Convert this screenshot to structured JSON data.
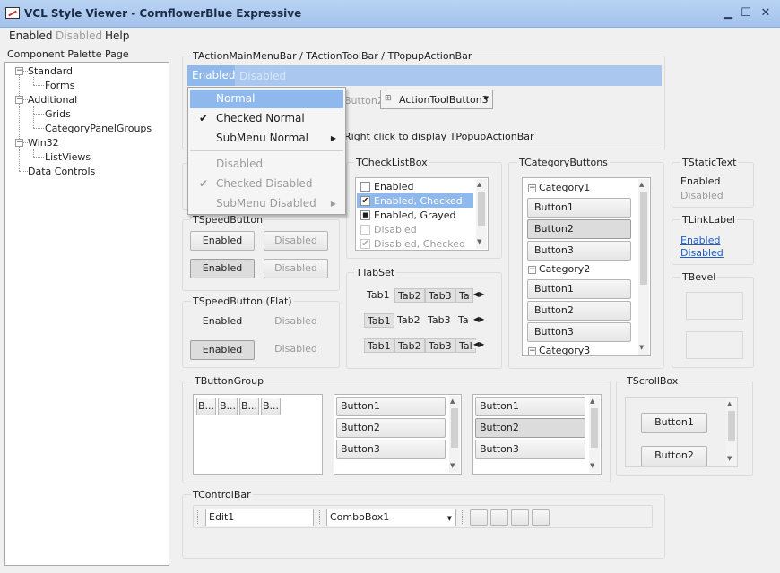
{
  "window": {
    "title": "VCL Style Viewer - CornflowerBlue Expressive"
  },
  "menubar": {
    "items": [
      "Enabled",
      "Disabled",
      "Help"
    ]
  },
  "palette": {
    "title": "Component Palette Page",
    "tree": [
      {
        "label": "Standard",
        "children": [
          "Forms"
        ]
      },
      {
        "label": "Additional",
        "children": [
          "Grids",
          "CategoryPanelGroups"
        ]
      },
      {
        "label": "Win32",
        "children": [
          "ListViews"
        ]
      },
      {
        "label": "Data Controls",
        "children": []
      }
    ]
  },
  "action": {
    "title": "TActionMainMenuBar / TActionToolBar / TPopupActionBar",
    "menu_enabled": "Enabled",
    "menu_disabled": "Disabled",
    "toolbutton2": "Button2",
    "toolbutton3": "ActionToolButton3",
    "hint": "Right click to display TPopupActionBar"
  },
  "popup": {
    "items": [
      {
        "label": "Normal",
        "check": "",
        "sub": ""
      },
      {
        "label": "Checked Normal",
        "check": "✔",
        "sub": ""
      },
      {
        "label": "SubMenu Normal",
        "check": "",
        "sub": "▶"
      },
      {
        "label": "Disabled",
        "check": "",
        "sub": ""
      },
      {
        "label": "Checked Disabled",
        "check": "✔",
        "sub": ""
      },
      {
        "label": "SubMenu Disabled",
        "check": "",
        "sub": "▶"
      }
    ]
  },
  "speed": {
    "title": "TSpeedButton",
    "enabled": "Enabled",
    "disabled": "Disabled"
  },
  "speedflat": {
    "title": "TSpeedButton (Flat)",
    "enabled": "Enabled",
    "disabled": "Disabled"
  },
  "checklist": {
    "title": "TCheckListBox",
    "items": [
      {
        "label": "Enabled",
        "mark": ""
      },
      {
        "label": "Enabled, Checked",
        "mark": "✔"
      },
      {
        "label": "Enabled, Grayed",
        "mark": "■"
      },
      {
        "label": "Disabled",
        "mark": ""
      },
      {
        "label": "Disabled, Checked",
        "mark": "✔"
      }
    ]
  },
  "tabset": {
    "title": "TTabSet",
    "tabs": [
      "Tab1",
      "Tab2",
      "Tab3",
      "Ta",
      "Tab1",
      "Tab2",
      "Tab3",
      "Ta",
      "Tab1",
      "Tab2",
      "Tab3",
      "Tal"
    ]
  },
  "catbuttons": {
    "title": "TCategoryButtons",
    "cat1": "Category1",
    "cat2": "Category2",
    "cat3": "Category3",
    "buttons": [
      "Button1",
      "Button2",
      "Button3",
      "Button1",
      "Button2",
      "Button3"
    ]
  },
  "statictext": {
    "title": "TStaticText",
    "enabled": "Enabled",
    "disabled": "Disabled"
  },
  "linklabel": {
    "title": "TLinkLabel",
    "enabled": "Enabled",
    "disabled": "Disabled"
  },
  "bevel": {
    "title": "TBevel"
  },
  "buttongroup": {
    "title": "TButtonGroup",
    "small": [
      "B...",
      "B...",
      "B...",
      "B..."
    ],
    "list1": [
      "Button1",
      "Button2",
      "Button3"
    ],
    "list2": [
      "Button1",
      "Button2",
      "Button3"
    ]
  },
  "scrollbox": {
    "title": "TScrollBox",
    "b1": "Button1",
    "b2": "Button2"
  },
  "controlbar": {
    "title": "TControlBar",
    "edit": "Edit1",
    "combo": "ComboBox1"
  }
}
